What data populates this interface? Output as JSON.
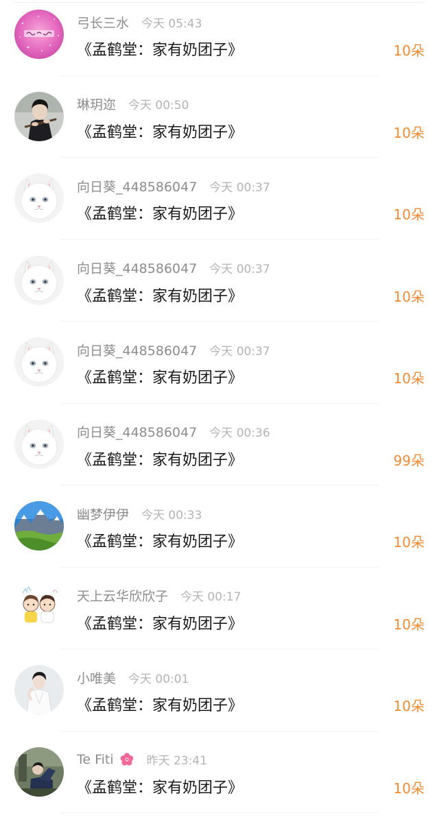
{
  "rows": [
    {
      "avatar": "pink-sparkle-avatar",
      "username": "弓长三水",
      "time": "今天 05:43",
      "gift": "《孟鹤堂：家有奶团子》",
      "count": "10朵"
    },
    {
      "avatar": "flute-player-avatar",
      "username": "琳玥迩",
      "time": "今天 00:50",
      "gift": "《孟鹤堂：家有奶团子》",
      "count": "10朵"
    },
    {
      "avatar": "white-cat-avatar",
      "username": "向日葵_448586047",
      "time": "今天 00:37",
      "gift": "《孟鹤堂：家有奶团子》",
      "count": "10朵"
    },
    {
      "avatar": "white-cat-avatar",
      "username": "向日葵_448586047",
      "time": "今天 00:37",
      "gift": "《孟鹤堂：家有奶团子》",
      "count": "10朵"
    },
    {
      "avatar": "white-cat-avatar",
      "username": "向日葵_448586047",
      "time": "今天 00:37",
      "gift": "《孟鹤堂：家有奶团子》",
      "count": "10朵"
    },
    {
      "avatar": "white-cat-avatar",
      "username": "向日葵_448586047",
      "time": "今天 00:36",
      "gift": "《孟鹤堂：家有奶团子》",
      "count": "99朵"
    },
    {
      "avatar": "mountain-landscape-avatar",
      "username": "幽梦伊伊",
      "time": "今天 00:33",
      "gift": "《孟鹤堂：家有奶团子》",
      "count": "10朵"
    },
    {
      "avatar": "cartoon-kids-avatar",
      "username": "天上云华欣欣子",
      "time": "今天 00:17",
      "gift": "《孟鹤堂：家有奶团子》",
      "count": "10朵"
    },
    {
      "avatar": "person-white-outfit-avatar",
      "username": "小唯美",
      "time": "今天 00:01",
      "gift": "《孟鹤堂：家有奶团子》",
      "count": "10朵"
    },
    {
      "avatar": "person-seated-avatar",
      "username": "Te Fiti",
      "badge": "pink-flower-icon",
      "time": "昨天 23:41",
      "gift": "《孟鹤堂：家有奶团子》",
      "count": "10朵"
    }
  ],
  "colors": {
    "username": "#8c8c8c",
    "time": "#b3b3b3",
    "gift_text": "#1a1a1a",
    "count": "#f08a33"
  }
}
